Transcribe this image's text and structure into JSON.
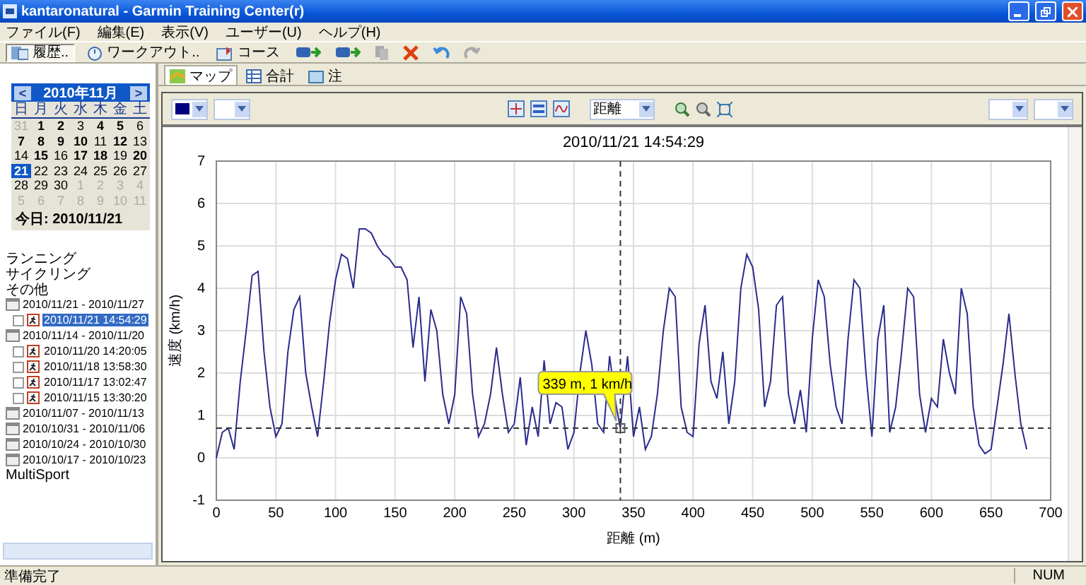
{
  "window": {
    "title": "kantaronatural - Garmin Training Center(r)"
  },
  "menu": [
    "ファイル(F)",
    "編集(E)",
    "表示(V)",
    "ユーザー(U)",
    "ヘルプ(H)"
  ],
  "toolbar": {
    "buttons": [
      {
        "label": "履歴..",
        "kind": "history",
        "selected": true
      },
      {
        "label": "ワークアウト..",
        "kind": "workout",
        "selected": false
      },
      {
        "label": "コース",
        "kind": "course",
        "selected": false
      }
    ],
    "tools": [
      {
        "kind": "receive",
        "disabled": false
      },
      {
        "kind": "send",
        "disabled": false
      },
      {
        "kind": "copy",
        "disabled": true
      },
      {
        "kind": "delete",
        "disabled": false
      },
      {
        "kind": "undo",
        "disabled": false
      },
      {
        "kind": "redo",
        "disabled": true
      }
    ]
  },
  "calendar": {
    "title": "2010年11月",
    "prev": "<",
    "next": ">",
    "weekdays": [
      "日",
      "月",
      "火",
      "水",
      "木",
      "金",
      "土"
    ],
    "days": [
      {
        "day": "31",
        "muted": true,
        "bold": false,
        "selected": false
      },
      {
        "day": "1",
        "muted": false,
        "bold": true,
        "selected": false
      },
      {
        "day": "2",
        "muted": false,
        "bold": true,
        "selected": false
      },
      {
        "day": "3",
        "muted": false,
        "bold": false,
        "selected": false
      },
      {
        "day": "4",
        "muted": false,
        "bold": true,
        "selected": false
      },
      {
        "day": "5",
        "muted": false,
        "bold": true,
        "selected": false
      },
      {
        "day": "6",
        "muted": false,
        "bold": false,
        "selected": false
      },
      {
        "day": "7",
        "muted": false,
        "bold": true,
        "selected": false
      },
      {
        "day": "8",
        "muted": false,
        "bold": true,
        "selected": false
      },
      {
        "day": "9",
        "muted": false,
        "bold": true,
        "selected": false
      },
      {
        "day": "10",
        "muted": false,
        "bold": true,
        "selected": false
      },
      {
        "day": "11",
        "muted": false,
        "bold": false,
        "selected": false
      },
      {
        "day": "12",
        "muted": false,
        "bold": true,
        "selected": false
      },
      {
        "day": "13",
        "muted": false,
        "bold": false,
        "selected": false
      },
      {
        "day": "14",
        "muted": false,
        "bold": false,
        "selected": false
      },
      {
        "day": "15",
        "muted": false,
        "bold": true,
        "selected": false
      },
      {
        "day": "16",
        "muted": false,
        "bold": false,
        "selected": false
      },
      {
        "day": "17",
        "muted": false,
        "bold": true,
        "selected": false
      },
      {
        "day": "18",
        "muted": false,
        "bold": true,
        "selected": false
      },
      {
        "day": "19",
        "muted": false,
        "bold": false,
        "selected": false
      },
      {
        "day": "20",
        "muted": false,
        "bold": true,
        "selected": false
      },
      {
        "day": "21",
        "muted": false,
        "bold": true,
        "selected": true
      },
      {
        "day": "22",
        "muted": false,
        "bold": false,
        "selected": false
      },
      {
        "day": "23",
        "muted": false,
        "bold": false,
        "selected": false
      },
      {
        "day": "24",
        "muted": false,
        "bold": false,
        "selected": false
      },
      {
        "day": "25",
        "muted": false,
        "bold": false,
        "selected": false
      },
      {
        "day": "26",
        "muted": false,
        "bold": false,
        "selected": false
      },
      {
        "day": "27",
        "muted": false,
        "bold": false,
        "selected": false
      },
      {
        "day": "28",
        "muted": false,
        "bold": false,
        "selected": false
      },
      {
        "day": "29",
        "muted": false,
        "bold": false,
        "selected": false
      },
      {
        "day": "30",
        "muted": false,
        "bold": false,
        "selected": false
      },
      {
        "day": "1",
        "muted": true,
        "bold": false,
        "selected": false
      },
      {
        "day": "2",
        "muted": true,
        "bold": false,
        "selected": false
      },
      {
        "day": "3",
        "muted": true,
        "bold": false,
        "selected": false
      },
      {
        "day": "4",
        "muted": true,
        "bold": false,
        "selected": false
      },
      {
        "day": "5",
        "muted": true,
        "bold": false,
        "selected": false
      },
      {
        "day": "6",
        "muted": true,
        "bold": false,
        "selected": false
      },
      {
        "day": "7",
        "muted": true,
        "bold": false,
        "selected": false
      },
      {
        "day": "8",
        "muted": true,
        "bold": false,
        "selected": false
      },
      {
        "day": "9",
        "muted": true,
        "bold": false,
        "selected": false
      },
      {
        "day": "10",
        "muted": true,
        "bold": false,
        "selected": false
      },
      {
        "day": "11",
        "muted": true,
        "bold": false,
        "selected": false
      }
    ],
    "today": "今日: 2010/11/21"
  },
  "tree": [
    {
      "label": "ランニング",
      "kind": "category"
    },
    {
      "label": "サイクリング",
      "kind": "category"
    },
    {
      "label": "その他",
      "kind": "category"
    },
    {
      "label": "2010/11/21 - 2010/11/27",
      "kind": "week",
      "children": [
        {
          "label": "2010/11/21 14:54:29",
          "selected": true
        }
      ]
    },
    {
      "label": "2010/11/14 - 2010/11/20",
      "kind": "week",
      "children": [
        {
          "label": "2010/11/20 14:20:05",
          "selected": false
        },
        {
          "label": "2010/11/18 13:58:30",
          "selected": false
        },
        {
          "label": "2010/11/17 13:02:47",
          "selected": false
        },
        {
          "label": "2010/11/15 13:30:20",
          "selected": false
        }
      ]
    },
    {
      "label": "2010/11/07 - 2010/11/13",
      "kind": "week"
    },
    {
      "label": "2010/10/31 - 2010/11/06",
      "kind": "week"
    },
    {
      "label": "2010/10/24 - 2010/10/30",
      "kind": "week"
    },
    {
      "label": "2010/10/17 - 2010/10/23",
      "kind": "week"
    },
    {
      "label": "MultiSport",
      "kind": "category"
    }
  ],
  "tabs": [
    {
      "label": "マップ",
      "kind": "map",
      "selected": true
    },
    {
      "label": "合計",
      "kind": "totals",
      "selected": false
    },
    {
      "label": "注",
      "kind": "notes",
      "selected": false
    }
  ],
  "chart_toolbar": {
    "axis_dropdown": "距離"
  },
  "chart": {
    "chart_data": {
      "type": "line",
      "title": "2010/11/21 14:54:29",
      "xlabel": "距離 (m)",
      "ylabel": "速度 (km/h)",
      "xlim": [
        0,
        700
      ],
      "ylim": [
        -1,
        7
      ],
      "xticks": [
        0,
        50,
        100,
        150,
        200,
        250,
        300,
        350,
        400,
        450,
        500,
        550,
        600,
        650,
        700
      ],
      "yticks": [
        -1,
        0,
        1,
        2,
        3,
        4,
        5,
        6,
        7
      ],
      "x": [
        0,
        5,
        10,
        15,
        20,
        25,
        30,
        35,
        40,
        45,
        50,
        55,
        60,
        65,
        70,
        75,
        80,
        85,
        90,
        95,
        100,
        105,
        110,
        115,
        120,
        125,
        130,
        135,
        140,
        145,
        150,
        155,
        160,
        165,
        170,
        175,
        180,
        185,
        190,
        195,
        200,
        205,
        210,
        215,
        220,
        225,
        230,
        235,
        240,
        245,
        250,
        255,
        260,
        265,
        270,
        275,
        280,
        285,
        290,
        295,
        300,
        305,
        310,
        315,
        320,
        325,
        330,
        335,
        339,
        345,
        350,
        355,
        360,
        365,
        370,
        375,
        380,
        385,
        390,
        395,
        400,
        405,
        410,
        415,
        420,
        425,
        430,
        435,
        440,
        445,
        450,
        455,
        460,
        465,
        470,
        475,
        480,
        485,
        490,
        495,
        500,
        505,
        510,
        515,
        520,
        525,
        530,
        535,
        540,
        545,
        550,
        555,
        560,
        565,
        570,
        575,
        580,
        585,
        590,
        595,
        600,
        605,
        610,
        615,
        620,
        625,
        630,
        635,
        640,
        645,
        650,
        655,
        660,
        665,
        670,
        675,
        680
      ],
      "series": [
        {
          "color": "#2b2b8c",
          "values": [
            0,
            0.6,
            0.7,
            0.2,
            1.8,
            3,
            4.3,
            4.4,
            2.5,
            1.2,
            0.5,
            0.8,
            2.5,
            3.5,
            3.8,
            2,
            1.2,
            0.5,
            1.8,
            3.2,
            4.2,
            4.8,
            4.7,
            4,
            5.4,
            5.4,
            5.3,
            5,
            4.8,
            4.7,
            4.5,
            4.5,
            4.2,
            2.6,
            3.8,
            1.8,
            3.5,
            3,
            1.5,
            0.8,
            1.5,
            3.8,
            3.4,
            1.5,
            0.5,
            0.8,
            1.5,
            2.6,
            1.5,
            0.6,
            0.8,
            1.9,
            0.3,
            1.2,
            0.5,
            2.3,
            0.8,
            1.3,
            1.2,
            0.2,
            0.6,
            2,
            3,
            2.2,
            0.8,
            0.6,
            2.4,
            1.3,
            0.7,
            2.4,
            0.5,
            1.2,
            0.2,
            0.5,
            1.5,
            3,
            4,
            3.8,
            1.2,
            0.6,
            0.5,
            2.7,
            3.6,
            1.8,
            1.4,
            2.5,
            0.8,
            1.8,
            4,
            4.8,
            4.5,
            3.5,
            1.2,
            1.8,
            3.6,
            3.8,
            1.5,
            0.8,
            1.6,
            0.6,
            2.8,
            4.2,
            3.8,
            2.2,
            1.2,
            0.8,
            2.8,
            4.2,
            4,
            2,
            0.5,
            2.8,
            3.6,
            0.6,
            1.2,
            2.5,
            4,
            3.8,
            1.5,
            0.6,
            1.4,
            1.2,
            2.8,
            2,
            1.5,
            4,
            3.4,
            1.2,
            0.3,
            0.1,
            0.2,
            1.2,
            2.2,
            3.4,
            2,
            0.8,
            0.2
          ]
        }
      ],
      "grid": true,
      "ref_lines": [
        {
          "axis": "x",
          "value": 339
        },
        {
          "axis": "y",
          "value": 0.7
        }
      ],
      "annotations": [
        {
          "text": "339 m, 1 km/h",
          "x": 339,
          "y": 0.7
        }
      ]
    }
  },
  "status_bar": {
    "message": "準備完了",
    "indicator": "NUM"
  }
}
